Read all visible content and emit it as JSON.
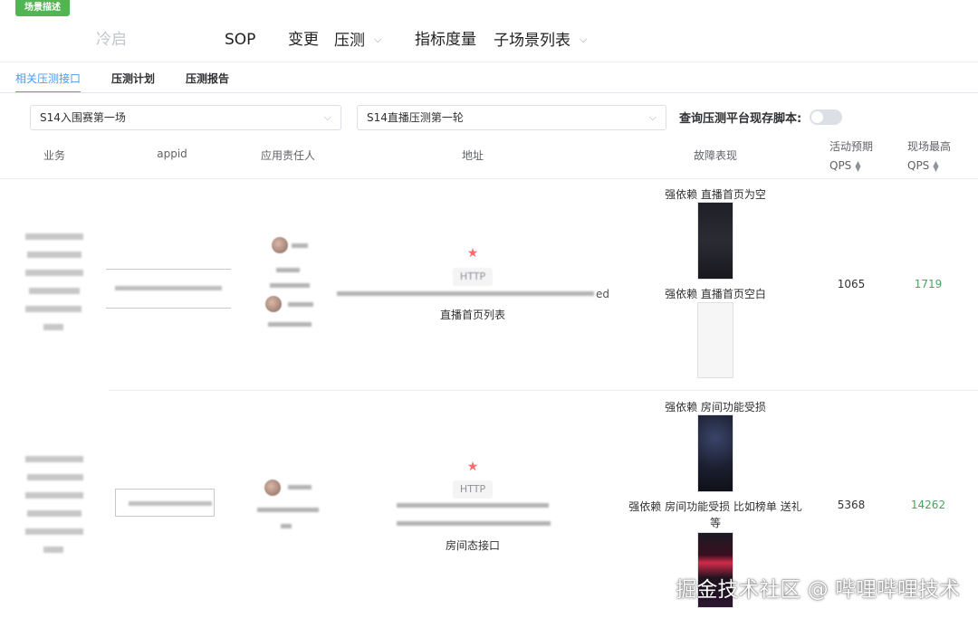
{
  "badge": "场景描述",
  "topnav": {
    "items": [
      "冷启",
      "SOP",
      "变更",
      "压测",
      "指标度量",
      "子场景列表"
    ]
  },
  "tabs": [
    "相关压测接口",
    "压测计划",
    "压测报告"
  ],
  "filters": {
    "select1": "S14入围赛第一场",
    "select2": "S14直播压测第一轮",
    "switch_label": "查询压测平台现存脚本:",
    "switch_on": false
  },
  "table": {
    "headers": {
      "business": "业务",
      "appid": "appid",
      "owner": "应用责任人",
      "address": "地址",
      "fault": "故障表现",
      "expected_qps_1": "活动预期",
      "expected_qps_2": "QPS",
      "peak_qps_1": "现场最高",
      "peak_qps_2": "QPS"
    },
    "rows": [
      {
        "protocol": "HTTP",
        "api_name": "直播首页列表",
        "url_tail": "ed",
        "faults": [
          "强依赖 直播首页为空",
          "强依赖 直播首页空白"
        ],
        "expected_qps": "1065",
        "peak_qps": "1719"
      },
      {
        "protocol": "HTTP",
        "api_name": "房间态接口",
        "faults": [
          "强依赖 房间功能受损",
          "强依赖 房间功能受损 比如榜单 送礼",
          "等"
        ],
        "expected_qps": "5368",
        "peak_qps": "14262"
      }
    ]
  },
  "watermark": "掘金技术社区 @ 哔哩哔哩技术",
  "colors": {
    "accent": "#409eff",
    "badge": "#52b452",
    "peak": "#48a35c",
    "star": "#f56c6c"
  }
}
